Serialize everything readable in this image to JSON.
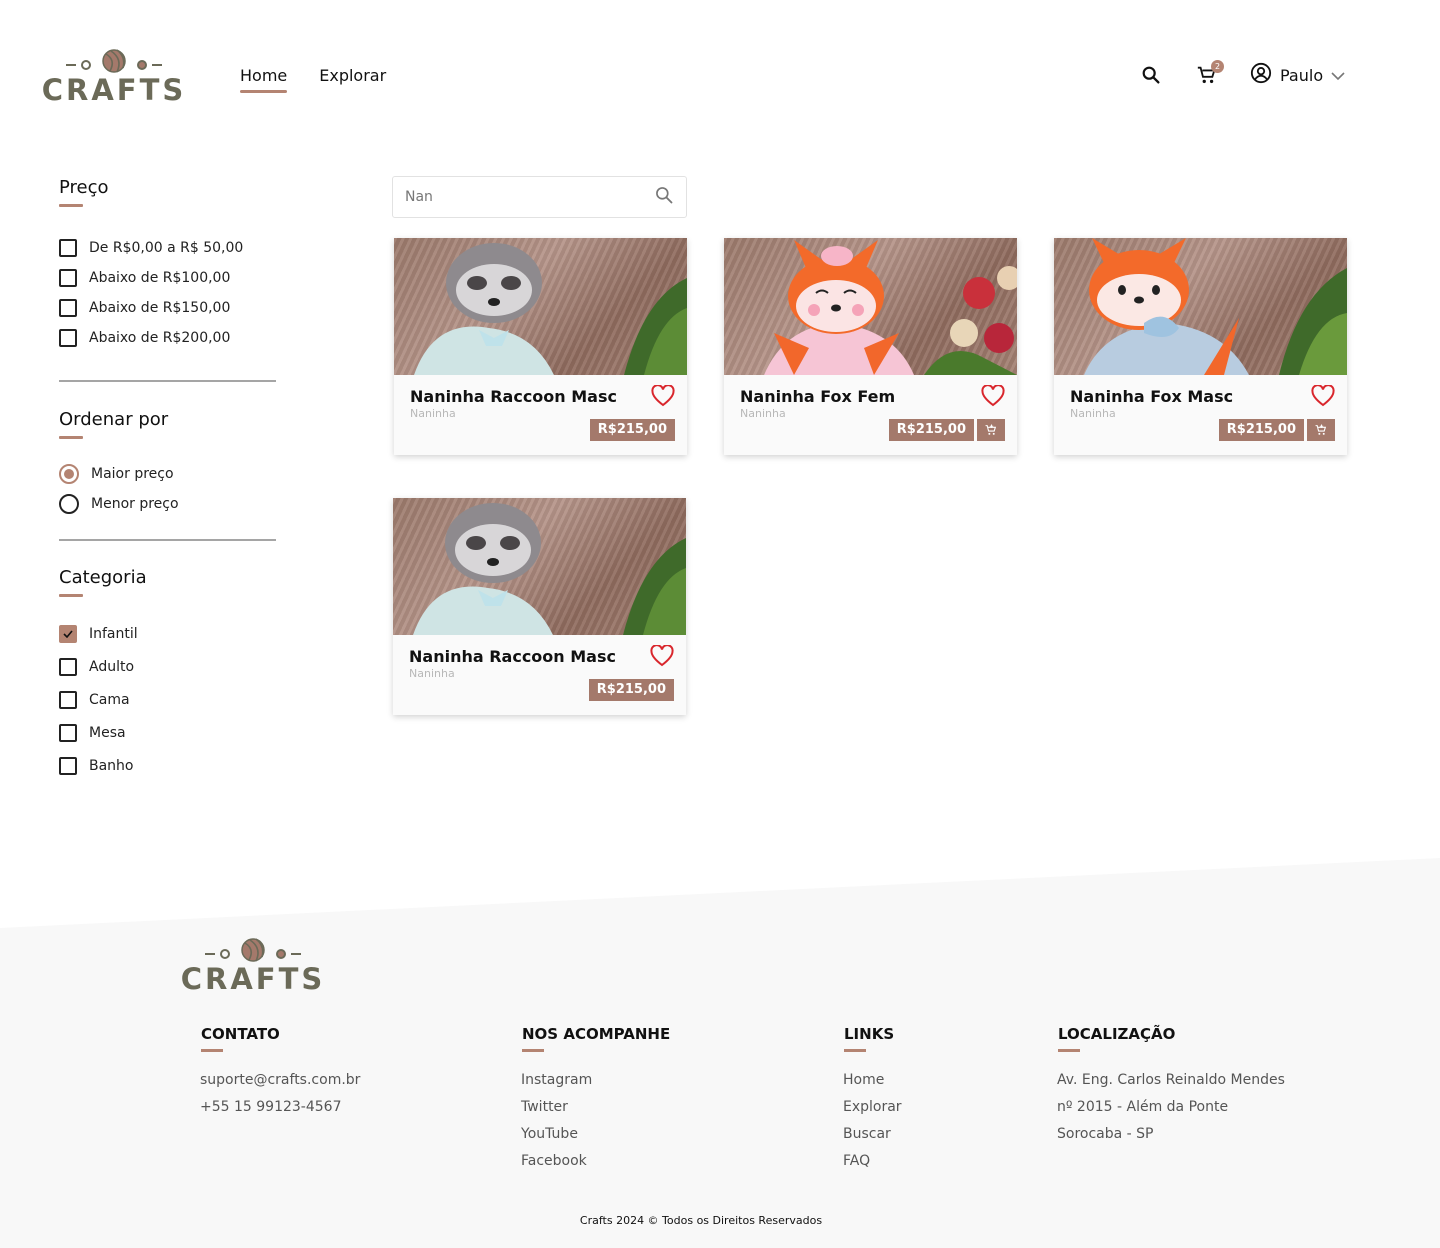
{
  "brand": {
    "name": "CRAFTS",
    "accent": "#b48472",
    "logo_color": "#6b6a58"
  },
  "nav": {
    "items": [
      "Home",
      "Explorar"
    ],
    "active": "Home"
  },
  "header": {
    "cart_count": "2",
    "user_name": "Paulo"
  },
  "filters": {
    "price": {
      "title": "Preço",
      "options": [
        "De R$0,00 a R$ 50,00",
        "Abaixo de R$100,00",
        "Abaixo de R$150,00",
        "Abaixo de R$200,00"
      ]
    },
    "sort": {
      "title": "Ordenar por",
      "options": [
        "Maior preço",
        "Menor preço"
      ],
      "selected": "Maior preço"
    },
    "category": {
      "title": "Categoria",
      "options": [
        "Infantil",
        "Adulto",
        "Cama",
        "Mesa",
        "Banho"
      ],
      "checked": [
        "Infantil"
      ]
    }
  },
  "search": {
    "value": "Nan"
  },
  "products": [
    {
      "name": "Naninha Raccoon Masc",
      "category": "Naninha",
      "price": "R$215,00",
      "image": "raccoon"
    },
    {
      "name": "Naninha Fox Fem",
      "category": "Naninha",
      "price": "R$215,00",
      "image": "fox-pink"
    },
    {
      "name": "Naninha Fox Masc",
      "category": "Naninha",
      "price": "R$215,00",
      "image": "fox-blue"
    },
    {
      "name": "Naninha Raccoon Masc",
      "category": "Naninha",
      "price": "R$215,00",
      "image": "raccoon"
    }
  ],
  "footer": {
    "contact": {
      "title": "CONTATO",
      "items": [
        "suporte@crafts.com.br",
        "+55 15 99123-4567"
      ]
    },
    "social": {
      "title": "NOS ACOMPANHE",
      "items": [
        "Instagram",
        "Twitter",
        "YouTube",
        "Facebook"
      ]
    },
    "links": {
      "title": "LINKS",
      "items": [
        "Home",
        "Explorar",
        "Buscar",
        "FAQ"
      ]
    },
    "location": {
      "title": "LOCALIZAÇÃO",
      "items": [
        "Av. Eng. Carlos Reinaldo Mendes",
        "nº 2015  - Além da Ponte",
        "Sorocaba - SP"
      ]
    },
    "copyright": "Crafts 2024 © Todos os Direitos Reservados"
  }
}
